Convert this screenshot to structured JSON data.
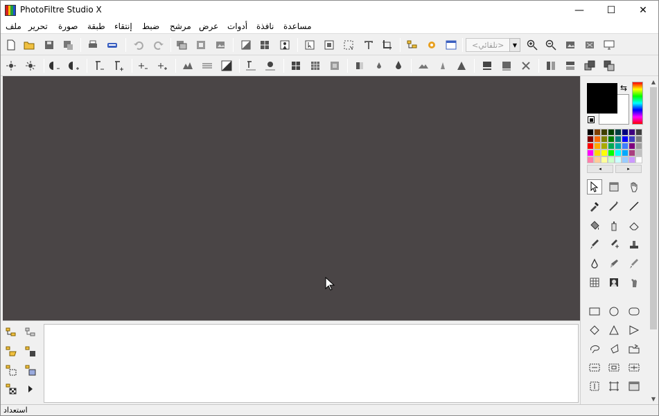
{
  "window": {
    "title": "PhotoFiltre Studio X",
    "minimize_glyph": "—",
    "maximize_glyph": "☐",
    "close_glyph": "✕"
  },
  "menu": {
    "items": [
      {
        "name": "file",
        "label": "ملف"
      },
      {
        "name": "edit",
        "label": "تحرير"
      },
      {
        "name": "image",
        "label": "صورة"
      },
      {
        "name": "layer",
        "label": "طبقة"
      },
      {
        "name": "selection",
        "label": "إنتقاء"
      },
      {
        "name": "adjust",
        "label": "ضبط"
      },
      {
        "name": "filter",
        "label": "مرشح"
      },
      {
        "name": "view",
        "label": "عرض"
      },
      {
        "name": "tools",
        "label": "أدوات"
      },
      {
        "name": "window",
        "label": "نافذة"
      },
      {
        "name": "help",
        "label": "مساعدة"
      }
    ]
  },
  "toolbar": {
    "zoom_value": "<تلقائي>",
    "zoom_arrow_glyph": "▼"
  },
  "palette": {
    "colors": [
      "#000000",
      "#7f3f00",
      "#3f3f00",
      "#003f00",
      "#003f3f",
      "#00007f",
      "#3f007f",
      "#3f3f3f",
      "#7f0000",
      "#ff6a00",
      "#7f7f00",
      "#007f00",
      "#007f7f",
      "#0000ff",
      "#3f3fbf",
      "#7f7f7f",
      "#ff0000",
      "#ffaa00",
      "#aaaa00",
      "#00aa55",
      "#00aaaa",
      "#3f7fff",
      "#7f007f",
      "#9f9f9f",
      "#ff00ff",
      "#ffd700",
      "#ffff00",
      "#00ff00",
      "#00ffff",
      "#00aaff",
      "#aa3f7f",
      "#c0c0c0",
      "#ff7faa",
      "#ffcc99",
      "#ffff99",
      "#ccffcc",
      "#ccffff",
      "#99ccff",
      "#cc99ff",
      "#ffffff"
    ],
    "prev_glyph": "◂",
    "next_glyph": "▸"
  },
  "scrollbar": {
    "up_glyph": "▲",
    "down_glyph": "▼"
  },
  "status": {
    "text": "استعداد"
  },
  "colors": {
    "workspace": "#4a4546",
    "foreground": "#000000",
    "background": "#ffffff"
  }
}
